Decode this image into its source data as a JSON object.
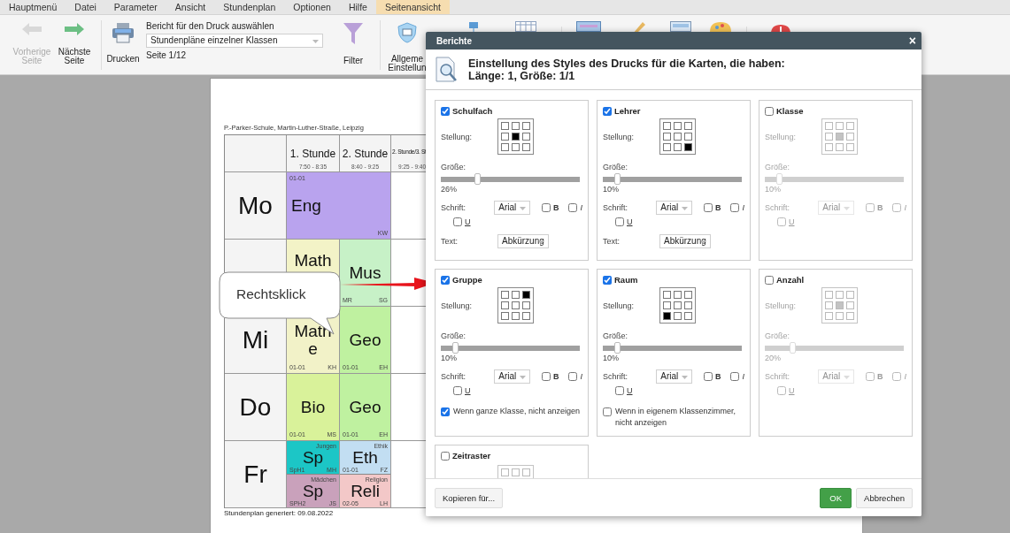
{
  "menu": [
    {
      "label": "Hauptmenü",
      "selected": false
    },
    {
      "label": "Datei",
      "selected": false
    },
    {
      "label": "Parameter",
      "selected": false
    },
    {
      "label": "Ansicht",
      "selected": false
    },
    {
      "label": "Stundenplan",
      "selected": false
    },
    {
      "label": "Optionen",
      "selected": false
    },
    {
      "label": "Hilfe",
      "selected": false
    },
    {
      "label": "Seitenansicht",
      "selected": true
    }
  ],
  "toolbar": {
    "prev": {
      "label": "Vorherige Seite",
      "disabled": true
    },
    "next": {
      "label": "Nächste Seite",
      "disabled": false
    },
    "print": "Drucken",
    "report_label": "Bericht für den Druck auswählen",
    "report_select": "Stundenpläne einzelner Klassen",
    "page": "Seite 1/12",
    "filter": "Filter",
    "general": "Allgeme Einstellun"
  },
  "timetable": {
    "school": "P.-Parker-Schule, Martin-Luther-Straße, Leipzig",
    "footer": "Stundenplan generiert: 09.08.2022",
    "periods": [
      {
        "name": "1. Stunde",
        "time": "7:50 - 8:35",
        "kind": "normal"
      },
      {
        "name": "2. Stunde",
        "time": "8:40 - 9:25",
        "kind": "normal"
      },
      {
        "name": "2. Stunde/3. St",
        "time": "9:25 - 9:40",
        "kind": "small"
      }
    ],
    "days": [
      {
        "name": "Mo",
        "slots": [
          {
            "kind": "wide",
            "subject": "Eng",
            "top_left": "01-01",
            "bottom_right": "KW",
            "color": "#b9a3ee"
          }
        ]
      },
      {
        "slots": [
          {
            "kind": "upper",
            "subject": "Math",
            "color": "#f3f3c7"
          },
          {
            "kind": "normal",
            "subject": "Mus",
            "bottom_left": "MR",
            "bottom_right": "SG",
            "color": "#c7f1c7"
          }
        ]
      },
      {
        "name": "Mi",
        "slots": [
          {
            "kind": "normal",
            "subject": "Mathe",
            "bottom_left": "01-01",
            "bottom_right": "KH",
            "color": "#f2f2c8"
          },
          {
            "kind": "normal",
            "subject": "Geo",
            "bottom_left": "01-01",
            "bottom_right": "EH",
            "color": "#bff1a0"
          }
        ]
      },
      {
        "name": "Do",
        "slots": [
          {
            "kind": "normal",
            "subject": "Bio",
            "bottom_left": "01-01",
            "bottom_right": "MS",
            "color": "#d9f29a"
          },
          {
            "kind": "normal",
            "subject": "Geo",
            "bottom_left": "01-01",
            "bottom_right": "EH",
            "color": "#bff1a0"
          }
        ]
      },
      {
        "name": "Fr",
        "slots": [
          {
            "kind": "split",
            "parts": [
              {
                "subject": "Sp",
                "top_right": "Jungen",
                "bottom_left": "SpH1",
                "bottom_right": "MH",
                "color": "#1cc6c6"
              },
              {
                "subject": "Sp",
                "top_right": "Mädchen",
                "bottom_left": "SPH2",
                "bottom_right": "JS",
                "color": "#c9a1bb"
              }
            ]
          },
          {
            "kind": "split",
            "parts": [
              {
                "subject": "Eth",
                "top_right": "Ethik",
                "bottom_left": "01-01",
                "bottom_right": "FZ",
                "color": "#c2def2"
              },
              {
                "subject": "Reli",
                "top_right": "Religion",
                "bottom_left": "02-05",
                "bottom_right": "LH",
                "color": "#f3c8c8"
              }
            ]
          }
        ]
      }
    ]
  },
  "callout": "Rechtsklick",
  "dialog": {
    "title": "Berichte",
    "close": "×",
    "heading": [
      "Einstellung des Styles des Drucks für die Karten, die haben:",
      "Länge: 1, Größe: 1/1"
    ],
    "cards": [
      {
        "label": "Schulfach",
        "checked": true,
        "stellung_label": "Stellung:",
        "stellung": [
          {
            "selected": false
          },
          {
            "selected": false
          },
          {
            "selected": false
          },
          {
            "selected": false
          },
          {
            "selected": true
          },
          {
            "selected": false
          },
          {
            "selected": false
          },
          {
            "selected": false
          },
          {
            "selected": false
          }
        ],
        "size_label": "Größe:",
        "size": {
          "level": 0.26,
          "reading": "26%"
        },
        "font_label": "Schrift:",
        "font": "Arial",
        "bold": {
          "label": "B",
          "checked": false
        },
        "italic": {
          "label": "I",
          "checked": false
        },
        "underline": {
          "label": "U",
          "checked": false
        },
        "extra": {
          "kind": "select",
          "label": "Text:",
          "value": "Abkürzung"
        }
      },
      {
        "label": "Lehrer",
        "checked": true,
        "stellung_label": "Stellung:",
        "stellung": [
          {
            "selected": false
          },
          {
            "selected": false
          },
          {
            "selected": false
          },
          {
            "selected": false
          },
          {
            "selected": false
          },
          {
            "selected": false
          },
          {
            "selected": false
          },
          {
            "selected": false
          },
          {
            "selected": true
          }
        ],
        "size_label": "Größe:",
        "size": {
          "level": 0.1,
          "reading": "10%"
        },
        "font_label": "Schrift:",
        "font": "Arial",
        "bold": {
          "label": "B",
          "checked": false
        },
        "italic": {
          "label": "I",
          "checked": false
        },
        "underline": {
          "label": "U",
          "checked": false
        },
        "extra": {
          "kind": "select",
          "label": "Text:",
          "value": "Abkürzung"
        }
      },
      {
        "label": "Klasse",
        "checked": false,
        "stellung_label": "Stellung:",
        "stellung": [
          {
            "selected": false
          },
          {
            "selected": false
          },
          {
            "selected": false
          },
          {
            "selected": false
          },
          {
            "selected": true
          },
          {
            "selected": false
          },
          {
            "selected": false
          },
          {
            "selected": false
          },
          {
            "selected": false
          }
        ],
        "size_label": "Größe:",
        "size": {
          "level": 0.1,
          "reading": "10%"
        },
        "font_label": "Schrift:",
        "font": "Arial",
        "bold": {
          "label": "B",
          "checked": false
        },
        "italic": {
          "label": "I",
          "checked": false
        },
        "underline": {
          "label": "U",
          "checked": false
        }
      },
      {
        "label": "Gruppe",
        "checked": true,
        "stellung_label": "Stellung:",
        "stellung": [
          {
            "selected": false
          },
          {
            "selected": false
          },
          {
            "selected": true
          },
          {
            "selected": false
          },
          {
            "selected": false
          },
          {
            "selected": false
          },
          {
            "selected": false
          },
          {
            "selected": false
          },
          {
            "selected": false
          }
        ],
        "size_label": "Größe:",
        "size": {
          "level": 0.1,
          "reading": "10%"
        },
        "font_label": "Schrift:",
        "font": "Arial",
        "bold": {
          "label": "B",
          "checked": false
        },
        "italic": {
          "label": "I",
          "checked": false
        },
        "underline": {
          "label": "U",
          "checked": false
        },
        "extra": {
          "kind": "checkbox",
          "label": "Wenn ganze Klasse, nicht anzeigen",
          "checked": true
        }
      },
      {
        "label": "Raum",
        "checked": true,
        "stellung_label": "Stellung:",
        "stellung": [
          {
            "selected": false
          },
          {
            "selected": false
          },
          {
            "selected": false
          },
          {
            "selected": false
          },
          {
            "selected": false
          },
          {
            "selected": false
          },
          {
            "selected": true
          },
          {
            "selected": false
          },
          {
            "selected": false
          }
        ],
        "size_label": "Größe:",
        "size": {
          "level": 0.1,
          "reading": "10%"
        },
        "font_label": "Schrift:",
        "font": "Arial",
        "bold": {
          "label": "B",
          "checked": false
        },
        "italic": {
          "label": "I",
          "checked": false
        },
        "underline": {
          "label": "U",
          "checked": false
        },
        "extra": {
          "kind": "checkbox",
          "label": "Wenn in eigenem Klassenzimmer, nicht anzeigen",
          "checked": false
        }
      },
      {
        "label": "Anzahl",
        "checked": false,
        "stellung_label": "Stellung:",
        "stellung": [
          {
            "selected": false
          },
          {
            "selected": false
          },
          {
            "selected": false
          },
          {
            "selected": false
          },
          {
            "selected": true
          },
          {
            "selected": false
          },
          {
            "selected": false
          },
          {
            "selected": false
          },
          {
            "selected": false
          }
        ],
        "size_label": "Größe:",
        "size": {
          "level": 0.2,
          "reading": "20%"
        },
        "font_label": "Schrift:",
        "font": "Arial",
        "bold": {
          "label": "B",
          "checked": false
        },
        "italic": {
          "label": "I",
          "checked": false
        },
        "underline": {
          "label": "U",
          "checked": false
        }
      },
      {
        "label": "Zeitraster",
        "checked": false,
        "stellung": [
          {
            "selected": false
          },
          {
            "selected": false
          },
          {
            "selected": false
          }
        ]
      }
    ],
    "buttons": {
      "copy": "Kopieren für...",
      "ok": "OK",
      "cancel": "Abbrechen"
    }
  }
}
